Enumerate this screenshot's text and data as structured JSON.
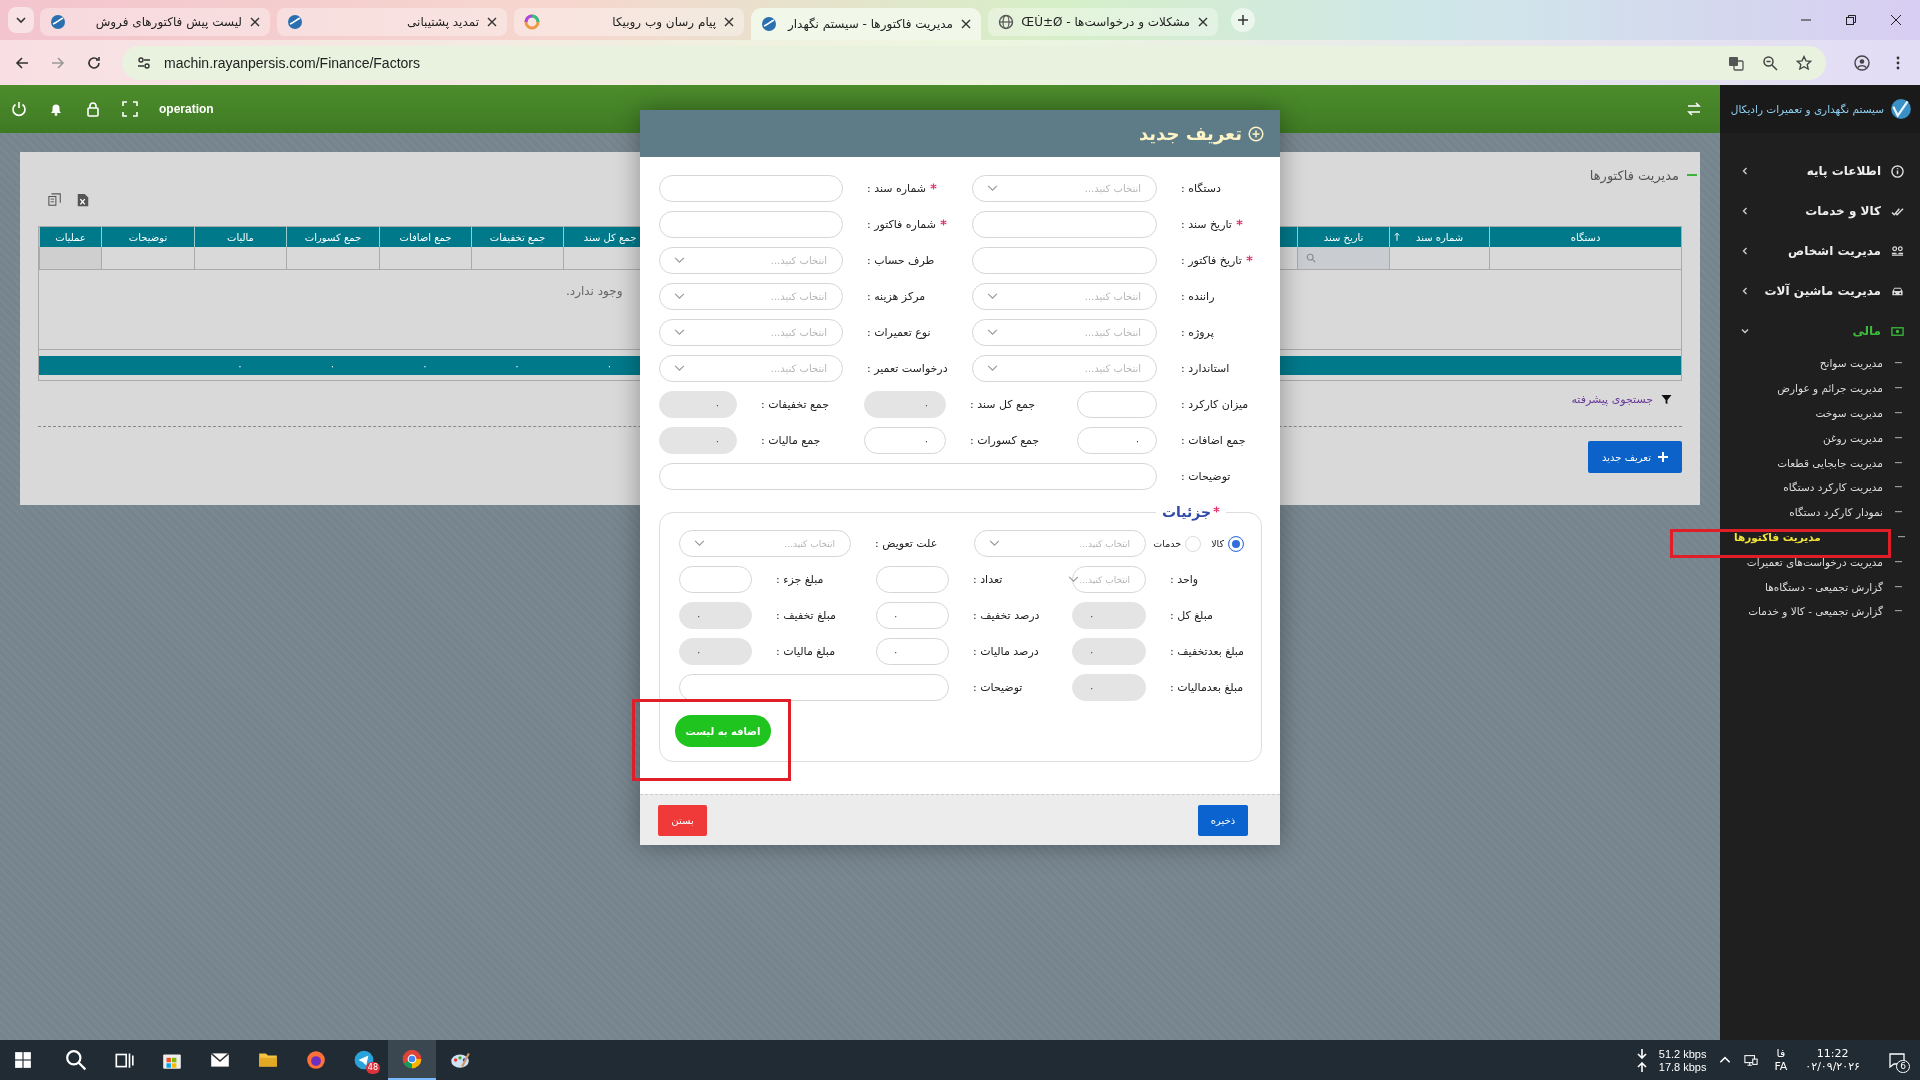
{
  "browser": {
    "tabs": [
      {
        "title": "مشکلات و درخواست‌ها - ŒÙ±Ø",
        "kind": "globe",
        "selected": false
      },
      {
        "title": "مدیریت فاکتورها - سیستم نگهدار",
        "kind": "site",
        "selected": true
      },
      {
        "title": "پیام رسان وب روبیکا",
        "kind": "colorful",
        "selected": false
      },
      {
        "title": "تمدید پشتیبانی",
        "kind": "site",
        "selected": false
      },
      {
        "title": "لیست پیش فاکتورهای فروش",
        "kind": "site",
        "selected": false
      }
    ],
    "url": "machin.rayanpersis.com/Finance/Factors"
  },
  "header": {
    "user": "operation"
  },
  "sidebar": {
    "title": "سیستم نگهداری و تعمیرات رادیکال",
    "items": [
      {
        "label": "اطلاعات پایه",
        "expanded": false
      },
      {
        "label": "کالا و خدمات",
        "expanded": false
      },
      {
        "label": "مدیریت اشخاص",
        "expanded": false
      },
      {
        "label": "مدیریت ماشین آلات",
        "expanded": false
      },
      {
        "label": "مالی",
        "expanded": true,
        "children": [
          {
            "label": "مدیریت سوانح",
            "selected": false
          },
          {
            "label": "مدیریت جرائم و عوارض",
            "selected": false
          },
          {
            "label": "مدیریت سوخت",
            "selected": false
          },
          {
            "label": "مدیریت روغن",
            "selected": false
          },
          {
            "label": "مدیریت جابجایی قطعات",
            "selected": false
          },
          {
            "label": "مدیریت کارکرد دستگاه",
            "selected": false
          },
          {
            "label": "نمودار کارکرد دستگاه",
            "selected": false
          },
          {
            "label": "مدیریت فاکتورها",
            "selected": true
          },
          {
            "label": "مدیریت درخواست‌های تعمیرات",
            "selected": false
          },
          {
            "label": "گزارش تجمیعی - دستگاه‌ها",
            "selected": false
          },
          {
            "label": "گزارش تجمیعی - کالا و خدمات",
            "selected": false
          }
        ]
      }
    ]
  },
  "page": {
    "title": "مدیریت فاکتورها",
    "table": {
      "columns_right": [
        {
          "label": "دستگاه",
          "sorted": false
        },
        {
          "label": "شماره سند",
          "sorted": true
        },
        {
          "label": "تاریخ سند",
          "sorted": false
        }
      ],
      "columns_left": [
        {
          "label": "جمع کل سند",
          "total": "۰"
        },
        {
          "label": "جمع تخفیفات",
          "total": "۰"
        },
        {
          "label": "جمع اضافات",
          "total": "۰"
        },
        {
          "label": "جمع کسورات",
          "total": "۰"
        },
        {
          "label": "مالیات",
          "total": "۰"
        },
        {
          "label": "توضیحات"
        },
        {
          "label": "عملیات"
        }
      ],
      "empty_message": "وجود ندارد."
    },
    "advanced_search": "جستجوی پیشرفته",
    "new_button": "تعریف جدید"
  },
  "modal": {
    "title": "تعریف جدید",
    "form": [
      [
        {
          "label": "دستگاه :",
          "kind": "select",
          "placeholder": "انتخاب کنید...",
          "required": false
        },
        {
          "label": "شماره سند :",
          "kind": "text",
          "required": true
        }
      ],
      [
        {
          "label": "تاریخ سند :",
          "kind": "text",
          "required": true
        },
        {
          "label": "شماره فاکتور :",
          "kind": "text",
          "required": true
        }
      ],
      [
        {
          "label": "تاریخ فاکتور :",
          "kind": "text",
          "required": true
        },
        {
          "label": "طرف حساب :",
          "kind": "select",
          "placeholder": "انتخاب کنید...",
          "required": false
        }
      ],
      [
        {
          "label": "راننده :",
          "kind": "select",
          "placeholder": "انتخاب کنید...",
          "required": false
        },
        {
          "label": "مرکز هزینه :",
          "kind": "select",
          "placeholder": "انتخاب کنید...",
          "required": false
        }
      ],
      [
        {
          "label": "پروژه :",
          "kind": "select",
          "placeholder": "انتخاب کنید...",
          "required": false
        },
        {
          "label": "نوع تعمیرات :",
          "kind": "select",
          "placeholder": "انتخاب کنید...",
          "required": false
        }
      ],
      [
        {
          "label": "استاندارد :",
          "kind": "select",
          "placeholder": "انتخاب کنید...",
          "required": false
        },
        {
          "label": "درخواست تعمیر :",
          "kind": "select",
          "placeholder": "انتخاب کنید...",
          "required": false
        }
      ],
      [
        {
          "label": "میزان کارکرد :",
          "kind": "text",
          "required": false
        },
        {
          "label": "جمع کل سند :",
          "kind": "readonly",
          "value": "۰",
          "required": false
        },
        {
          "label": "جمع تخفیفات :",
          "kind": "readonly",
          "value": "۰",
          "required": false
        }
      ],
      [
        {
          "label": "جمع اضافات :",
          "kind": "text",
          "value": "۰",
          "required": false
        },
        {
          "label": "جمع کسورات :",
          "kind": "text",
          "value": "۰",
          "required": false
        },
        {
          "label": "جمع مالیات :",
          "kind": "readonly",
          "value": "۰",
          "required": false
        }
      ],
      [
        {
          "label": "توضیحات :",
          "kind": "text",
          "required": false
        }
      ]
    ],
    "details": {
      "title": "جزئیات",
      "required": true,
      "rows": [
        [
          {
            "kind": "select",
            "options": [
              {
                "label": "کالا",
                "selected": true
              },
              {
                "label": "خدمات",
                "selected": false
              }
            ],
            "placeholder": "انتخاب کنید..."
          },
          {
            "label": "علت تعویض :",
            "kind": "select",
            "placeholder": "انتخاب کنید..."
          }
        ],
        [
          {
            "label": "واحد :",
            "kind": "select",
            "placeholder": "انتخاب کنید..."
          },
          {
            "label": "تعداد :",
            "kind": "text"
          },
          {
            "label": "مبلغ جزء :",
            "kind": "text"
          }
        ],
        [
          {
            "label": "مبلغ کل :",
            "kind": "readonly",
            "value": "۰"
          },
          {
            "label": "درصد تخفیف :",
            "kind": "text",
            "value": "۰"
          },
          {
            "label": "مبلغ تخفیف :",
            "kind": "readonly",
            "value": "۰"
          }
        ],
        [
          {
            "label": "مبلغ بعدتخفیف :",
            "kind": "readonly",
            "value": "۰"
          },
          {
            "label": "درصد مالیات :",
            "kind": "text",
            "value": "۰"
          },
          {
            "label": "مبلغ مالیات :",
            "kind": "readonly",
            "value": "۰"
          }
        ],
        [
          {
            "label": "مبلغ بعدمالیات :",
            "kind": "readonly",
            "value": "۰"
          },
          {
            "label": "توضیحات :",
            "kind": "text"
          }
        ]
      ]
    },
    "add_button": "اضافه به لیست",
    "save_button": "ذخیره",
    "close_button": "بستن"
  },
  "taskbar": {
    "apps": [
      {
        "kind": "search",
        "selected": false
      },
      {
        "kind": "taskview",
        "selected": false
      },
      {
        "kind": "store",
        "selected": false
      },
      {
        "kind": "mail",
        "selected": false
      },
      {
        "kind": "folder",
        "selected": false
      },
      {
        "kind": "firefox",
        "selected": false
      },
      {
        "kind": "telegram",
        "badge": "48",
        "selected": false
      },
      {
        "kind": "chrome",
        "selected": true
      },
      {
        "kind": "paint",
        "selected": false
      }
    ],
    "download_speed": "51.2 kbps",
    "upload_speed": "17.8 kbps",
    "language": "فا",
    "language_code": "FA",
    "time": "11:22",
    "date": "۰۲/۰۹/۲۰۲۶",
    "notifications": "6"
  }
}
